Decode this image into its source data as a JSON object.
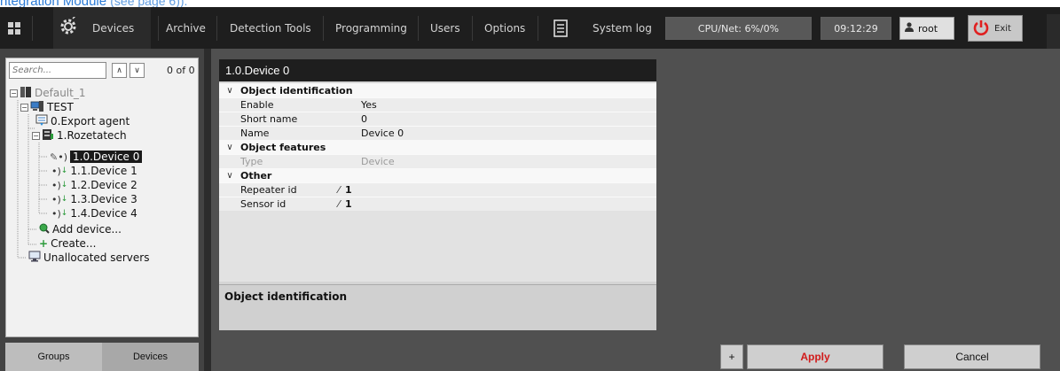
{
  "caption": {
    "text": "ntegration Module ",
    "paren": "(see page 6))."
  },
  "menu": {
    "devices": "Devices",
    "archive": "Archive",
    "detection_tools": "Detection Tools",
    "programming": "Programming",
    "users": "Users",
    "options": "Options",
    "system_log": "System log",
    "cpu_net": "CPU/Net: 6%/0%",
    "clock": "09:12:29",
    "user": "root",
    "exit": "Exit"
  },
  "search": {
    "placeholder": "Search...",
    "count": "0 of 0"
  },
  "tree": {
    "default": "Default_1",
    "test": "TEST",
    "export_agent": "0.Export agent",
    "rozetatech": "1.Rozetatech",
    "device0": "1.0.Device 0",
    "device1": "1.1.Device 1",
    "device2": "1.2.Device 2",
    "device3": "1.3.Device 3",
    "device4": "1.4.Device 4",
    "add_device": "Add device...",
    "create": "Create...",
    "unallocated": "Unallocated servers"
  },
  "tabs": {
    "groups": "Groups",
    "devices": "Devices"
  },
  "panel": {
    "title": "1.0.Device 0",
    "cat1": "Object identification",
    "enable_label": "Enable",
    "enable_value": "Yes",
    "short_label": "Short name",
    "short_value": "0",
    "name_label": "Name",
    "name_value": "Device 0",
    "cat2": "Object features",
    "type_label": "Type",
    "type_value": "Device",
    "cat3": "Other",
    "repeater_label": "Repeater id",
    "repeater_value": "1",
    "sensor_label": "Sensor id",
    "sensor_value": "1",
    "description": "Object identification"
  },
  "buttons": {
    "plus": "+",
    "apply": "Apply",
    "cancel": "Cancel"
  },
  "colors": {
    "apply_text": "#d11a1a",
    "exit_icon": "#e02020",
    "selected_bg": "#1a1a1a"
  }
}
